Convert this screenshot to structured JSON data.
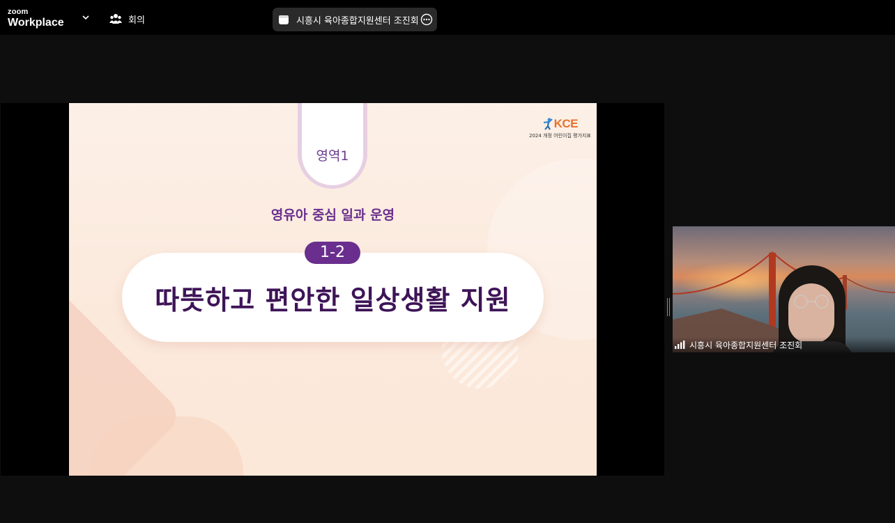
{
  "app": {
    "logo_small": "zoom",
    "logo_main": "Workplace"
  },
  "toolbar": {
    "meeting_label": "회의"
  },
  "meeting_title": {
    "text": "시흥시 육아종합지원센터 조진회"
  },
  "slide": {
    "area_label": "영역1",
    "subtitle": "영유아 중심 일과 운영",
    "number": "1-2",
    "title": "따뜻하고 편안한 일상생활 지원",
    "logo_text": "KCE",
    "logo_subtext": "2024 개정 어린이집 평가지표",
    "colors": {
      "purple": "#6a2f8e",
      "dark_purple": "#3e1457",
      "orange": "#e8722c"
    }
  },
  "participant": {
    "name": "시흥시 육아종합지원센터 조진회"
  },
  "icons": [
    "chevron-down-icon",
    "people-icon",
    "calendar-icon",
    "more-icon",
    "signal-icon"
  ]
}
